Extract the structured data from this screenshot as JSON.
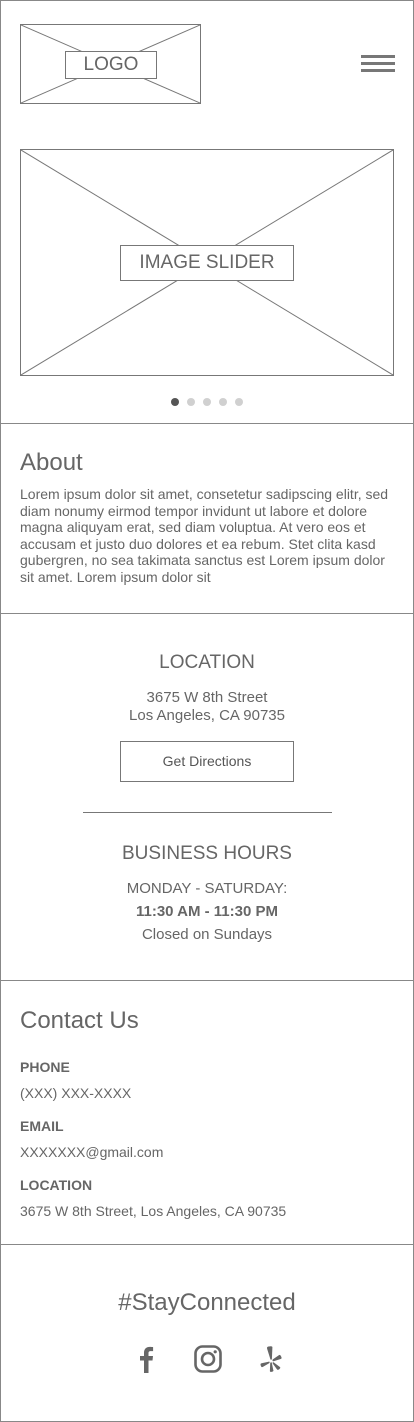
{
  "header": {
    "logo_text": "LOGO",
    "menu_icon": "hamburger-menu-icon"
  },
  "slider": {
    "label": "IMAGE SLIDER",
    "dot_count": 5,
    "active_index": 0
  },
  "about": {
    "title": "About",
    "body": "Lorem ipsum dolor sit amet, consetetur sadipscing elitr, sed diam nonumy eirmod tempor invidunt ut labore et dolore magna aliquyam erat, sed diam voluptua. At vero eos et accusam et justo duo dolores et ea rebum. Stet clita kasd gubergren, no sea takimata sanctus est Lorem ipsum dolor sit amet. Lorem ipsum dolor sit"
  },
  "location": {
    "title": "LOCATION",
    "address_line1": "3675 W 8th Street",
    "address_line2": "Los Angeles, CA 90735",
    "directions_label": "Get Directions"
  },
  "hours": {
    "title": "BUSINESS HOURS",
    "days": "MONDAY - SATURDAY:",
    "time": "11:30 AM - 11:30 PM",
    "closed": "Closed on Sundays"
  },
  "contact": {
    "title": "Contact Us",
    "phone_label": "PHONE",
    "phone_value": "(XXX) XXX-XXXX",
    "email_label": "EMAIL",
    "email_value": "XXXXXXX@gmail.com",
    "location_label": "LOCATION",
    "location_value": "3675 W 8th Street, Los Angeles, CA 90735"
  },
  "social": {
    "title": "#StayConnected",
    "icons": [
      "facebook-icon",
      "instagram-icon",
      "yelp-icon"
    ]
  },
  "colors": {
    "text": "#666666",
    "border": "#777777",
    "dot_active": "#555555",
    "dot_inactive": "#d0d0d0"
  }
}
